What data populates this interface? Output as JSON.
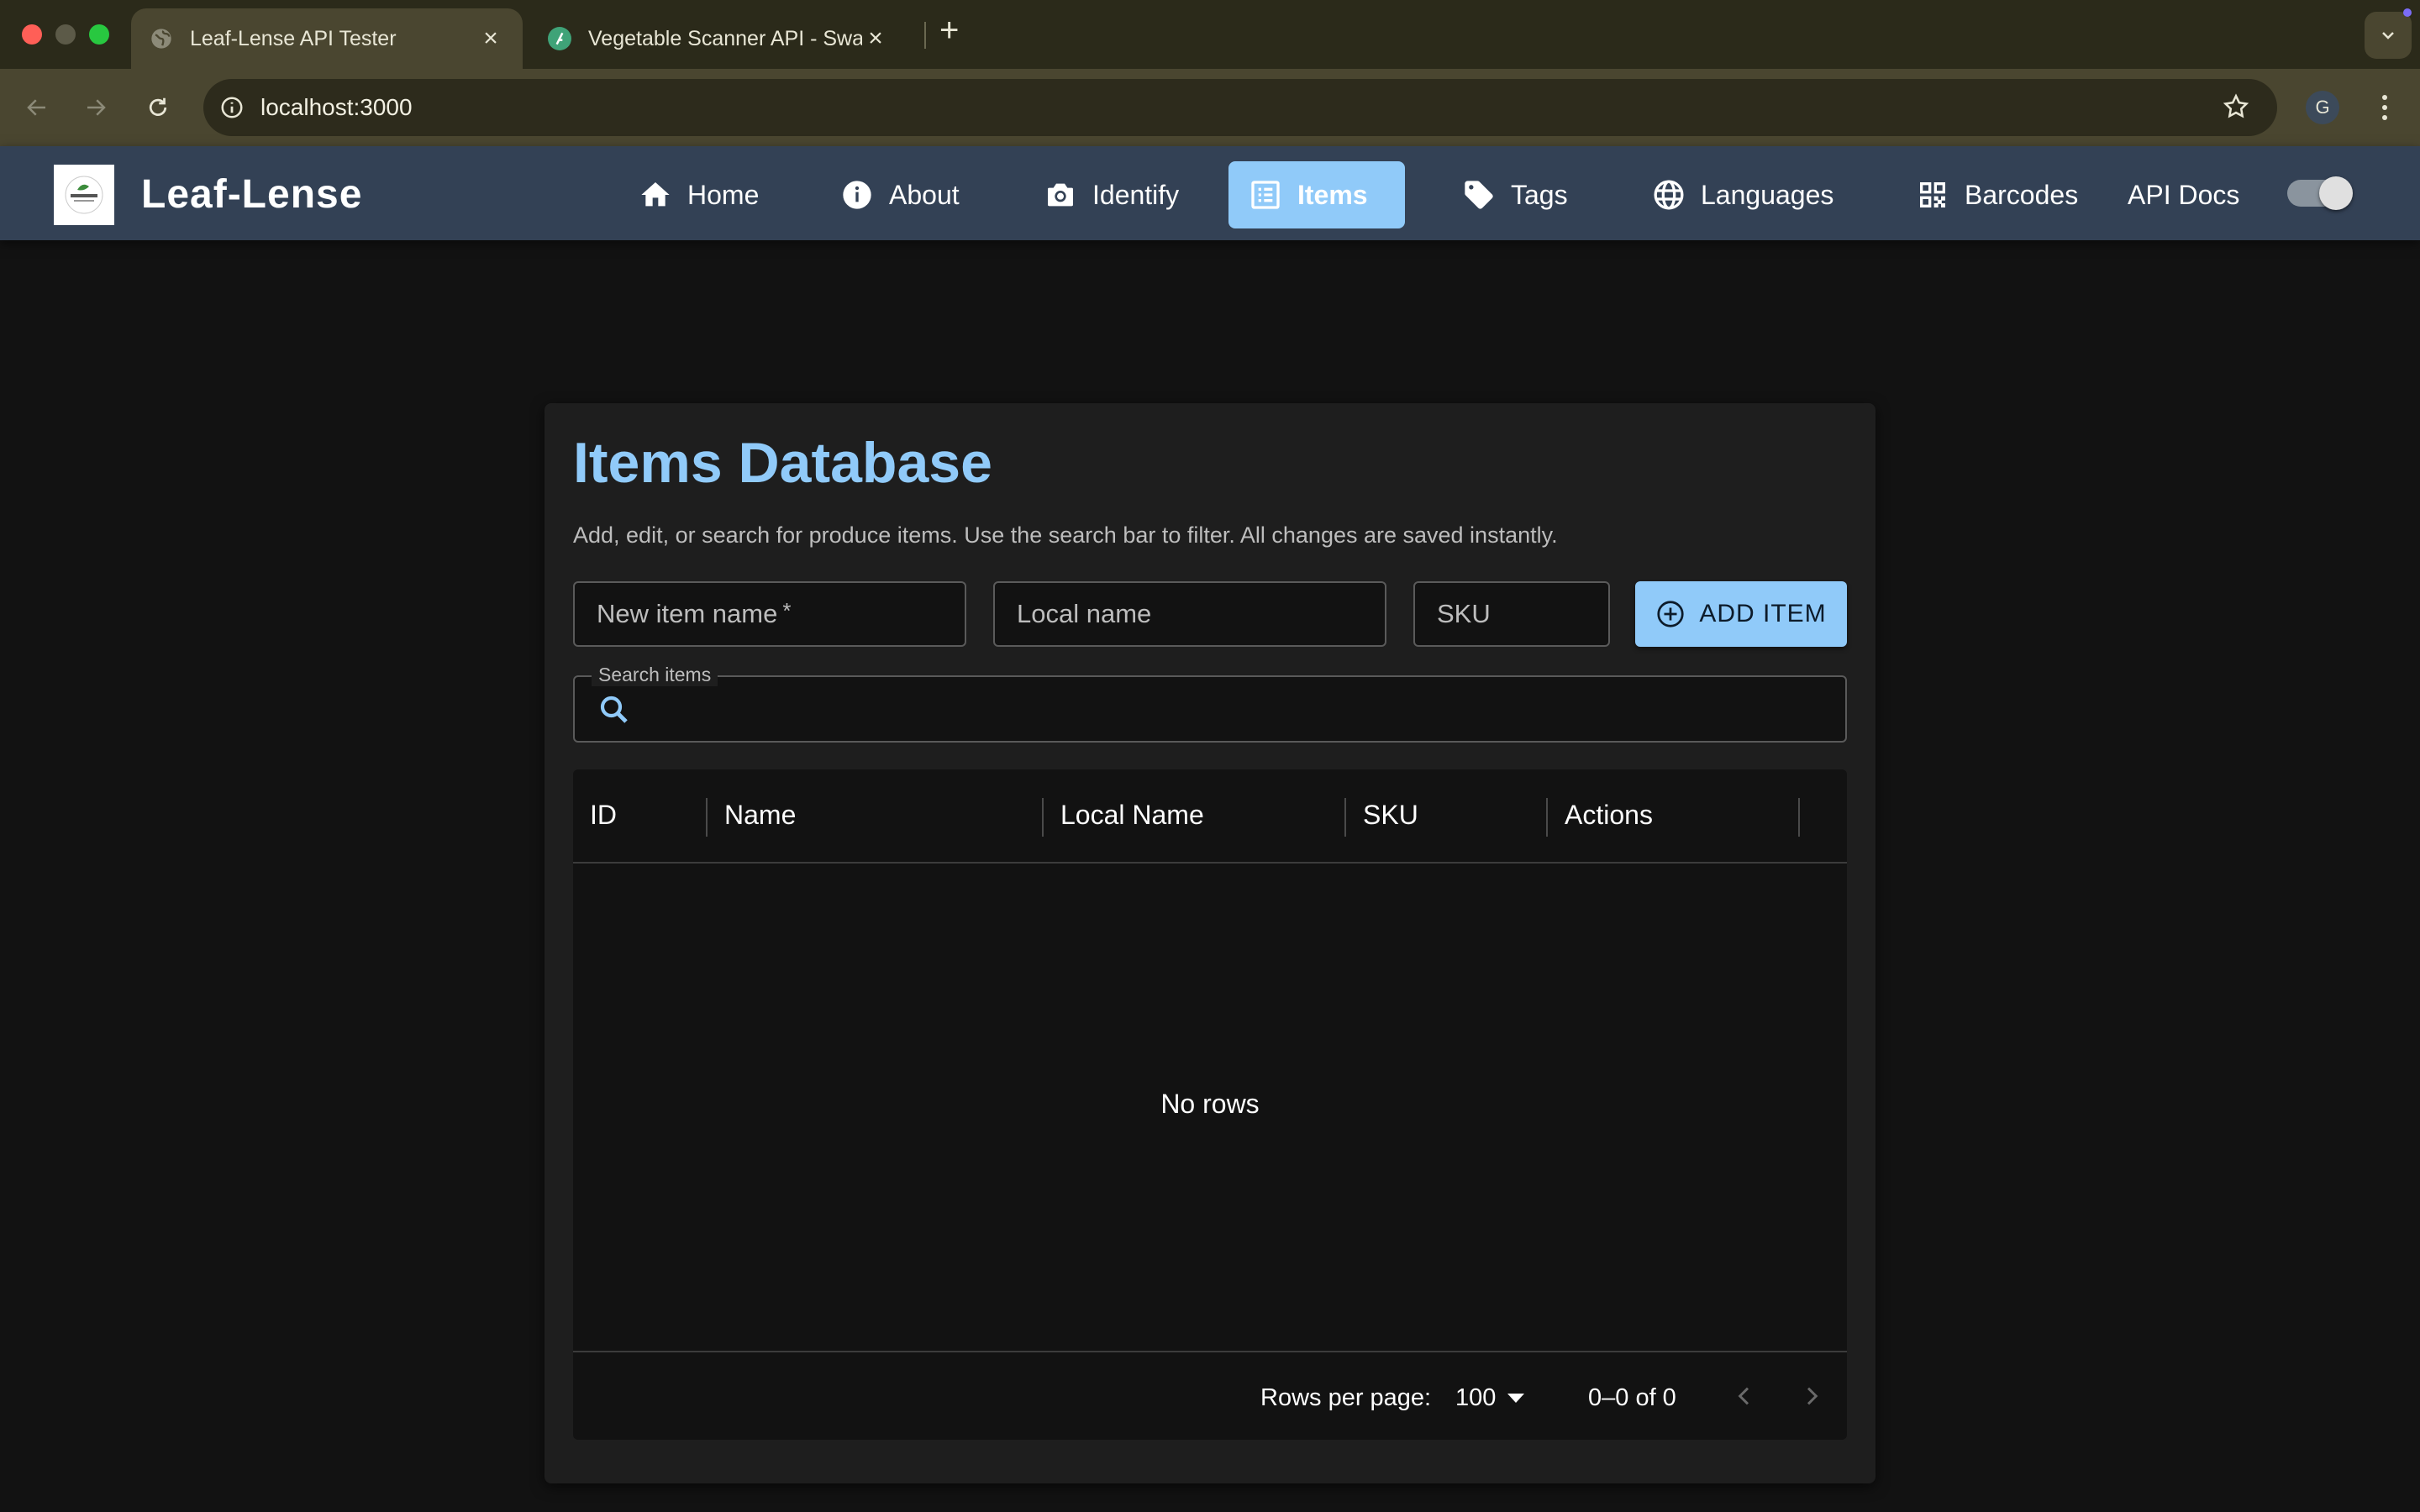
{
  "browser": {
    "tabs": [
      {
        "title": "Leaf-Lense API Tester",
        "active": true,
        "favicon": "globe-icon"
      },
      {
        "title": "Vegetable Scanner API - Swa",
        "active": false,
        "favicon": "swagger-icon"
      }
    ],
    "url": "localhost:3000",
    "profile_initial": "G"
  },
  "app": {
    "brand": "Leaf-Lense",
    "nav": [
      {
        "label": "Home",
        "icon": "home-icon"
      },
      {
        "label": "About",
        "icon": "info-icon"
      },
      {
        "label": "Identify",
        "icon": "camera-icon"
      },
      {
        "label": "Items",
        "icon": "list-icon",
        "active": true
      },
      {
        "label": "Tags",
        "icon": "tag-icon"
      },
      {
        "label": "Languages",
        "icon": "globe-icon"
      },
      {
        "label": "Barcodes",
        "icon": "qr-code-icon"
      },
      {
        "label": "API Docs"
      }
    ],
    "theme_toggle": "on"
  },
  "page": {
    "title": "Items Database",
    "subtitle": "Add, edit, or search for produce items. Use the search bar to filter. All changes are saved instantly.",
    "form": {
      "name_placeholder": "New item name",
      "required_mark": "*",
      "local_placeholder": "Local name",
      "sku_placeholder": "SKU",
      "add_label": "ADD ITEM"
    },
    "search": {
      "label": "Search items",
      "value": ""
    },
    "grid": {
      "columns": [
        "ID",
        "Name",
        "Local Name",
        "SKU",
        "Actions"
      ],
      "rows": [],
      "empty_text": "No rows",
      "rows_per_page_label": "Rows per page:",
      "rows_per_page": "100",
      "range": "0–0 of 0"
    }
  },
  "colors": {
    "accent": "#90caf9",
    "appbar": "#334155",
    "background": "#121212",
    "card": "#1e1e1e"
  }
}
